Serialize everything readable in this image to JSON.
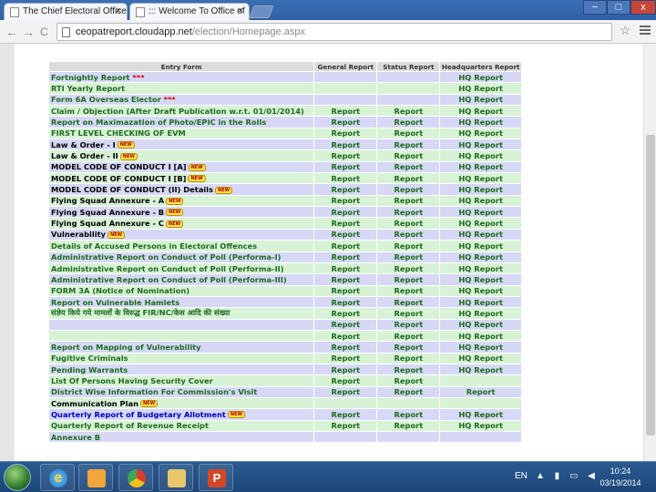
{
  "browser": {
    "tabs": [
      {
        "title": "The Chief Electoral Officer",
        "close": "×"
      },
      {
        "title": "::: Welcome To Office of",
        "close": "×"
      }
    ],
    "window_controls": {
      "minimize": "−",
      "maximize": "□",
      "close": "x"
    },
    "nav": {
      "back": "←",
      "forward": "→",
      "reload": "C"
    },
    "url_host": "ceopatreport.cloudapp.net",
    "url_path": "/election/Homepage.aspx",
    "star": "☆"
  },
  "table": {
    "headers": {
      "entry": "Entry Form",
      "general": "General Report",
      "status": "Status Report",
      "hq": "Headquarters Report"
    },
    "rows": [
      {
        "name": "Fortnightly Report",
        "stars": "***",
        "general": "",
        "status": "",
        "hq": "HQ Report",
        "bg": "b",
        "color": "green",
        "badge": ""
      },
      {
        "name": "RTI Yearly Report",
        "stars": "",
        "general": "",
        "status": "",
        "hq": "HQ Report",
        "bg": "l",
        "color": "green",
        "badge": ""
      },
      {
        "name": "Form 6A Overseas Elector",
        "stars": "***",
        "general": "",
        "status": "",
        "hq": "HQ Report",
        "bg": "b",
        "color": "green",
        "badge": ""
      },
      {
        "name": "Claim / Objection (After Draft Publication w.r.t. 01/01/2014)",
        "stars": "",
        "general": "Report",
        "status": "Report",
        "hq": "HQ Report",
        "bg": "l",
        "color": "green",
        "badge": ""
      },
      {
        "name": "Report on Maximazation of Photo/EPIC in the Rolls",
        "stars": "",
        "general": "Report",
        "status": "Report",
        "hq": "HQ Report",
        "bg": "b",
        "color": "green",
        "badge": ""
      },
      {
        "name": "FIRST LEVEL CHECKING OF EVM",
        "stars": "",
        "general": "Report",
        "status": "Report",
        "hq": "HQ Report",
        "bg": "l",
        "color": "green",
        "badge": ""
      },
      {
        "name": "Law & Order - I",
        "stars": "",
        "general": "Report",
        "status": "Report",
        "hq": "HQ Report",
        "bg": "b",
        "color": "black",
        "badge": "NEW"
      },
      {
        "name": "Law & Order - II",
        "stars": "",
        "general": "Report",
        "status": "Report",
        "hq": "HQ Report",
        "bg": "l",
        "color": "black",
        "badge": "NEW"
      },
      {
        "name": "MODEL CODE OF CONDUCT I [A]",
        "stars": "",
        "general": "Report",
        "status": "Report",
        "hq": "HQ Report",
        "bg": "b",
        "color": "black",
        "badge": "NEW"
      },
      {
        "name": "MODEL CODE OF CONDUCT I [B]",
        "stars": "",
        "general": "Report",
        "status": "Report",
        "hq": "HQ Report",
        "bg": "l",
        "color": "black",
        "badge": "NEW"
      },
      {
        "name": "MODEL CODE OF CONDUCT (II) Details",
        "stars": "",
        "general": "Report",
        "status": "Report",
        "hq": "HQ Report",
        "bg": "b",
        "color": "black",
        "badge": "NEW"
      },
      {
        "name": "Flying Squad Annexure - A",
        "stars": "",
        "general": "Report",
        "status": "Report",
        "hq": "HQ Report",
        "bg": "l",
        "color": "black",
        "badge": "NEW"
      },
      {
        "name": "Flying Squad Annexure - B",
        "stars": "",
        "general": "Report",
        "status": "Report",
        "hq": "HQ Report",
        "bg": "b",
        "color": "black",
        "badge": "NEW"
      },
      {
        "name": "Flying Squad Annexure - C",
        "stars": "",
        "general": "Report",
        "status": "Report",
        "hq": "HQ Report",
        "bg": "l",
        "color": "black",
        "badge": "NEW"
      },
      {
        "name": "Vulnerability",
        "stars": "",
        "general": "Report",
        "status": "Report",
        "hq": "HQ Report",
        "bg": "b",
        "color": "black",
        "badge": "NEW"
      },
      {
        "name": "Details of Accused Persons in Electoral Offences",
        "stars": "",
        "general": "Report",
        "status": "Report",
        "hq": "HQ Report",
        "bg": "l",
        "color": "green",
        "badge": ""
      },
      {
        "name": "Administrative Report on Conduct of Poll (Performa-I)",
        "stars": "",
        "general": "Report",
        "status": "Report",
        "hq": "HQ Report",
        "bg": "b",
        "color": "green",
        "badge": ""
      },
      {
        "name": "Administrative Report on Conduct of Poll (Performa-II)",
        "stars": "",
        "general": "Report",
        "status": "Report",
        "hq": "HQ Report",
        "bg": "l",
        "color": "green",
        "badge": ""
      },
      {
        "name": "Administrative Report on Conduct of Poll (Performa-III)",
        "stars": "",
        "general": "Report",
        "status": "Report",
        "hq": "HQ Report",
        "bg": "b",
        "color": "green",
        "badge": ""
      },
      {
        "name": "FORM 3A (Notice of Nomination)",
        "stars": "",
        "general": "Report",
        "status": "Report",
        "hq": "HQ Report",
        "bg": "l",
        "color": "green",
        "badge": ""
      },
      {
        "name": "Report on Vulnerable Hamlets",
        "stars": "",
        "general": "Report",
        "status": "Report",
        "hq": "HQ Report",
        "bg": "b",
        "color": "green",
        "badge": ""
      },
      {
        "name": "संज्ञेय किये गये मामलों के विरुद्ध FIR/NC/केस आदि की संख्या",
        "stars": "",
        "general": "Report",
        "status": "Report",
        "hq": "HQ Report",
        "bg": "l",
        "color": "green",
        "badge": ""
      },
      {
        "name": "",
        "stars": "",
        "general": "Report",
        "status": "Report",
        "hq": "HQ Report",
        "bg": "b",
        "color": "green",
        "badge": ""
      },
      {
        "name": "",
        "stars": "",
        "general": "Report",
        "status": "Report",
        "hq": "HQ Report",
        "bg": "l",
        "color": "green",
        "badge": ""
      },
      {
        "name": "Report on Mapping of Vulnerability",
        "stars": "",
        "general": "Report",
        "status": "Report",
        "hq": "HQ Report",
        "bg": "b",
        "color": "green",
        "badge": ""
      },
      {
        "name": "Fugitive Criminals",
        "stars": "",
        "general": "Report",
        "status": "Report",
        "hq": "HQ Report",
        "bg": "l",
        "color": "green",
        "badge": ""
      },
      {
        "name": "Pending Warrants",
        "stars": "",
        "general": "Report",
        "status": "Report",
        "hq": "HQ Report",
        "bg": "b",
        "color": "green",
        "badge": ""
      },
      {
        "name": "List Of Persons Having Security Cover",
        "stars": "",
        "general": "Report",
        "status": "Report",
        "hq": "",
        "bg": "l",
        "color": "green",
        "badge": ""
      },
      {
        "name": "District Wise Information For Commission's Visit",
        "stars": "",
        "general": "Report",
        "status": "Report",
        "hq": "Report",
        "bg": "b",
        "color": "green",
        "badge": ""
      },
      {
        "name": "Communication Plan",
        "stars": "",
        "general": "",
        "status": "",
        "hq": "",
        "bg": "l",
        "color": "black",
        "badge": "NEW"
      },
      {
        "name": "Quarterly Report of Budgetary Allotment",
        "stars": "",
        "general": "Report",
        "status": "Report",
        "hq": "HQ Report",
        "bg": "b",
        "color": "blue",
        "badge": "NEW"
      },
      {
        "name": "Quarterly Report of Revenue Receipt",
        "stars": "",
        "general": "Report",
        "status": "Report",
        "hq": "HQ Report",
        "bg": "l",
        "color": "green",
        "badge": ""
      },
      {
        "name": "Annexure B",
        "stars": "",
        "general": "",
        "status": "",
        "hq": "",
        "bg": "b",
        "color": "green",
        "badge": ""
      }
    ]
  },
  "taskbar": {
    "ie_glyph": "e",
    "ppt_glyph": "P",
    "language": "EN",
    "tray": "▲ ▮ ▭ ◀",
    "time": "10:24",
    "date": "03/19/2014"
  }
}
